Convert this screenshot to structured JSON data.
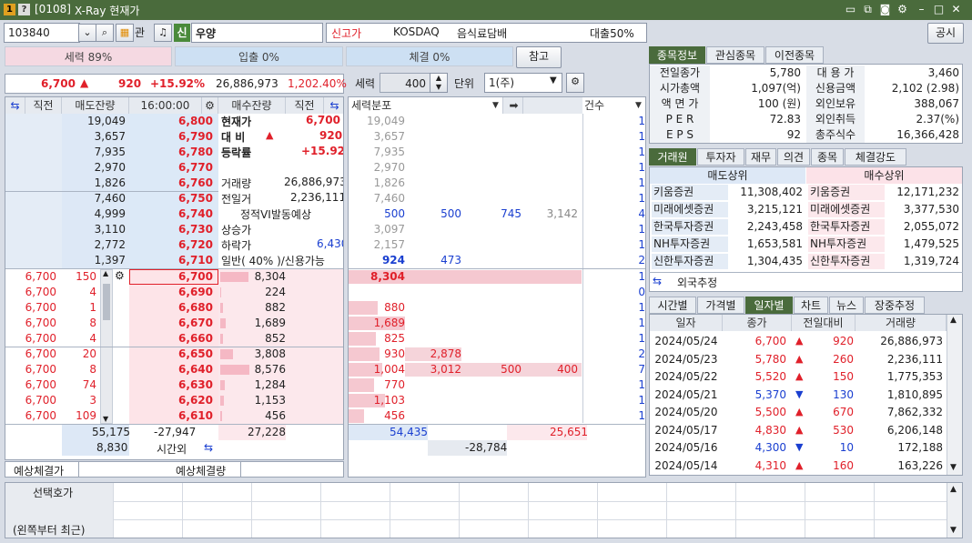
{
  "window": {
    "code_label": "[0108]",
    "title": "X-Ray 현재가"
  },
  "header": {
    "stock_code": "103840",
    "tag": "관",
    "credit_badge": "신",
    "stock_name": "우양",
    "high_label": "신고가",
    "market": "KOSDAQ",
    "sector": "음식료담배",
    "loan_ratio": "대출50%",
    "notice_label": "공시"
  },
  "strength": {
    "label": "세력 89%",
    "in_out": "입출 0%",
    "fill": "체결 0%",
    "ref_button": "참고"
  },
  "price_bar": {
    "price": "6,700",
    "change": "920",
    "rate": "+15.92%",
    "volume": "26,886,973",
    "vol_ratio": "1,202.40%"
  },
  "controls": {
    "power_label": "세력",
    "power_value": "400",
    "unit_label": "단위",
    "unit_value": "1(주)"
  },
  "book_header": {
    "prev": "직전",
    "ask_rem": "매도잔량",
    "time": "16:00:00",
    "bid_rem": "매수잔량",
    "prev2": "직전"
  },
  "asks": [
    {
      "rem": "19,049",
      "price": "6,800",
      "dist": "19,049"
    },
    {
      "rem": "3,657",
      "price": "6,790",
      "dist": "3,657"
    },
    {
      "rem": "7,935",
      "price": "6,780",
      "dist": "7,935"
    },
    {
      "rem": "2,970",
      "price": "6,770",
      "dist": "2,970"
    },
    {
      "rem": "1,826",
      "price": "6,760",
      "dist": "1,826"
    },
    {
      "rem": "7,460",
      "price": "6,750",
      "dist": "7,460"
    },
    {
      "rem": "4,999",
      "price": "6,740",
      "dist": "500",
      "d2": "500",
      "d3": "745",
      "d4": "3,142"
    },
    {
      "rem": "3,110",
      "price": "6,730",
      "dist": "3,097"
    },
    {
      "rem": "2,772",
      "price": "6,720",
      "dist": "2,157"
    },
    {
      "rem": "1,397",
      "price": "6,710",
      "dist": "924",
      "d2": "473"
    }
  ],
  "info": {
    "cur_label": "현재가",
    "cur_val": "6,700",
    "chg_label": "대 비",
    "chg_val": "920",
    "rate_label": "등락률",
    "rate_val": "+15.92",
    "vol_label": "거래량",
    "vol_val": "26,886,973",
    "prev_label": "전일거",
    "prev_val": "2,236,111",
    "vi_label": "정적VI발동예상",
    "up_label": "상승가",
    "down_label": "하락가",
    "down_val": "6,430",
    "margin_label": "일반( 40% )/신용가능"
  },
  "bids": [
    {
      "prev": "6,700",
      "qty": "150",
      "price": "6,700",
      "rem": "8,304",
      "dist": "8,304"
    },
    {
      "prev": "6,700",
      "qty": "4",
      "price": "6,690",
      "rem": "224",
      "dist": ""
    },
    {
      "prev": "6,700",
      "qty": "1",
      "price": "6,680",
      "rem": "882",
      "dist": "880"
    },
    {
      "prev": "6,700",
      "qty": "8",
      "price": "6,670",
      "rem": "1,689",
      "dist": "1,689"
    },
    {
      "prev": "6,700",
      "qty": "4",
      "price": "6,660",
      "rem": "852",
      "dist": "825"
    },
    {
      "prev": "6,700",
      "qty": "20",
      "price": "6,650",
      "rem": "3,808",
      "dist": "930",
      "d2": "2,878"
    },
    {
      "prev": "6,700",
      "qty": "8",
      "price": "6,640",
      "rem": "8,576",
      "dist": "1,004",
      "d2": "3,012",
      "d3": "500",
      "d4": "400"
    },
    {
      "prev": "6,700",
      "qty": "74",
      "price": "6,630",
      "rem": "1,284",
      "dist": "770"
    },
    {
      "prev": "6,700",
      "qty": "3",
      "price": "6,620",
      "rem": "1,153",
      "dist": "1,103"
    },
    {
      "prev": "6,700",
      "qty": "109",
      "price": "6,610",
      "rem": "456",
      "dist": "456"
    }
  ],
  "counts": [
    "1",
    "1",
    "1",
    "1",
    "1",
    "1",
    "4",
    "1",
    "1",
    "2",
    "1",
    "0",
    "1",
    "1",
    "1",
    "2",
    "7",
    "1",
    "1",
    "1"
  ],
  "totals": {
    "ask_total": "55,175",
    "diff": "-27,947",
    "bid_total": "27,228",
    "after": "8,830",
    "after_label": "시간외",
    "dist_ask": "54,435",
    "dist_bid": "25,651",
    "dist_diff": "-28,784"
  },
  "dist_header": {
    "label": "세력분포",
    "count": "건수"
  },
  "expect": {
    "price_label": "예상체결가",
    "qty_label": "예상체결량"
  },
  "summary_tabs": [
    "종목정보",
    "관심종목",
    "이전종목"
  ],
  "summary": [
    {
      "l": "전일종가",
      "v": "5,780",
      "l2": "대 용 가",
      "v2": "3,460"
    },
    {
      "l": "시가총액",
      "v": "1,097(억)",
      "l2": "신용금액",
      "v2": "2,102  (2.98)"
    },
    {
      "l": "액 면 가",
      "v": "100 (원)",
      "l2": "외인보유",
      "v2": "388,067"
    },
    {
      "l": "P E R",
      "v": "72.83",
      "l2": "외인취득",
      "v2": "2.37(%)"
    },
    {
      "l": "E P S",
      "v": "92",
      "l2": "총주식수",
      "v2": "16,366,428"
    }
  ],
  "broker_tabs": [
    "거래원",
    "투자자",
    "재무",
    "의견",
    "종목",
    "체결강도"
  ],
  "brokers": {
    "sell_title": "매도상위",
    "buy_title": "매수상위",
    "rows": [
      {
        "s": "키움증권",
        "sv": "11,308,402",
        "b": "키움증권",
        "bv": "12,171,232"
      },
      {
        "s": "미래에셋증권",
        "sv": "3,215,121",
        "b": "미래에셋증권",
        "bv": "3,377,530"
      },
      {
        "s": "한국투자증권",
        "sv": "2,243,458",
        "b": "한국투자증권",
        "bv": "2,055,072"
      },
      {
        "s": "NH투자증권",
        "sv": "1,653,581",
        "b": "NH투자증권",
        "bv": "1,479,525"
      },
      {
        "s": "신한투자증권",
        "sv": "1,304,435",
        "b": "신한투자증권",
        "bv": "1,319,724"
      }
    ],
    "foreign_label": "외국추정"
  },
  "daily_tabs": [
    "시간별",
    "가격별",
    "일자별",
    "차트",
    "뉴스",
    "장중추정"
  ],
  "daily_header": [
    "일자",
    "종가",
    "전일대비",
    "거래량"
  ],
  "daily": [
    {
      "d": "2024/05/24",
      "c": "6,700",
      "dir": "up",
      "chg": "920",
      "v": "26,886,973"
    },
    {
      "d": "2024/05/23",
      "c": "5,780",
      "dir": "up",
      "chg": "260",
      "v": "2,236,111"
    },
    {
      "d": "2024/05/22",
      "c": "5,520",
      "dir": "up",
      "chg": "150",
      "v": "1,775,353"
    },
    {
      "d": "2024/05/21",
      "c": "5,370",
      "dir": "down",
      "chg": "130",
      "v": "1,810,895"
    },
    {
      "d": "2024/05/20",
      "c": "5,500",
      "dir": "up",
      "chg": "670",
      "v": "7,862,332"
    },
    {
      "d": "2024/05/17",
      "c": "4,830",
      "dir": "up",
      "chg": "530",
      "v": "6,206,148"
    },
    {
      "d": "2024/05/16",
      "c": "4,300",
      "dir": "down",
      "chg": "10",
      "v": "172,188"
    },
    {
      "d": "2024/05/14",
      "c": "4,310",
      "dir": "up",
      "chg": "160",
      "v": "163,226"
    }
  ],
  "selector": {
    "title": "선택호가",
    "note": "(왼쪽부터 최근)"
  },
  "colors": {
    "up": "#e0202a",
    "down": "#1a3fd0",
    "accent": "#4a6b3c"
  }
}
